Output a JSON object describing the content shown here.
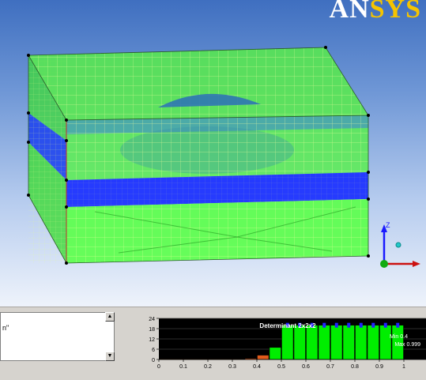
{
  "viewport": {
    "logo_text_main": "AN",
    "logo_text_accent": "SYS",
    "triad_axis_label": "Z"
  },
  "colors": {
    "mesh_green": "#5cff4c",
    "mesh_blue": "#1a33ff",
    "mesh_line": "#f0ff9c",
    "hist_bar": "#00ee00",
    "hist_bg": "#000000"
  },
  "message_panel": {
    "text": "n\""
  },
  "chart_data": {
    "type": "bar",
    "title": "Determinant 2x2x2",
    "min_label": "Min 0.4",
    "max_label": "Max 0.999",
    "x_ticks": [
      "0",
      "0.1",
      "0.2",
      "0.3",
      "0.4",
      "0.5",
      "0.6",
      "0.7",
      "0.8",
      "0.9",
      "1"
    ],
    "y_ticks": [
      "24",
      "18",
      "12",
      "6",
      "0"
    ],
    "xlim": [
      0,
      1
    ],
    "ylim": [
      0,
      24
    ],
    "bins": [
      {
        "x0": 0.0,
        "x1": 0.35,
        "value": 0.3
      },
      {
        "x0": 0.35,
        "x1": 0.4,
        "value": 0.6
      },
      {
        "x0": 0.4,
        "x1": 0.45,
        "value": 2.5
      },
      {
        "x0": 0.45,
        "x1": 0.5,
        "value": 7
      },
      {
        "x0": 0.5,
        "x1": 0.55,
        "value": 20
      },
      {
        "x0": 0.55,
        "x1": 0.6,
        "value": 20
      },
      {
        "x0": 0.6,
        "x1": 0.65,
        "value": 20
      },
      {
        "x0": 0.65,
        "x1": 0.7,
        "value": 20
      },
      {
        "x0": 0.7,
        "x1": 0.75,
        "value": 20
      },
      {
        "x0": 0.75,
        "x1": 0.8,
        "value": 20
      },
      {
        "x0": 0.8,
        "x1": 0.85,
        "value": 20
      },
      {
        "x0": 0.85,
        "x1": 0.9,
        "value": 20
      },
      {
        "x0": 0.9,
        "x1": 0.95,
        "value": 20
      },
      {
        "x0": 0.95,
        "x1": 1.0,
        "value": 20
      }
    ]
  }
}
